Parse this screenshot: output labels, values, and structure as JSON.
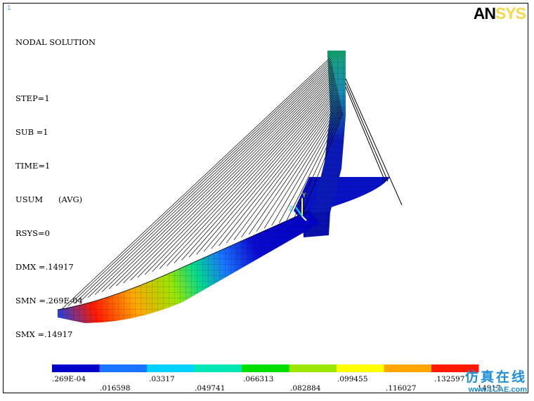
{
  "window_number": "1",
  "logo": {
    "part1": "AN",
    "part2": "SYS"
  },
  "info_lines": [
    "NODAL SOLUTION",
    "",
    "STEP=1",
    "SUB =1",
    "TIME=1",
    "USUM      (AVG)",
    "RSYS=0",
    "DMX =.14917",
    "SMN =.269E-04",
    "SMX =.14917"
  ],
  "legend": {
    "colors": [
      "#0000c8",
      "#1a73ff",
      "#00d2ff",
      "#00e6b4",
      "#00e000",
      "#9ae600",
      "#ffff00",
      "#ffa600",
      "#ff1a00"
    ],
    "labels_low": [
      ".269E-04",
      ".03317",
      ".066313",
      ".099455",
      ".132597"
    ],
    "labels_high": [
      ".016598",
      ".049741",
      ".082884",
      ".116027",
      ".14917"
    ]
  },
  "triad": {
    "x": "X",
    "y": "Y",
    "z": "Z"
  },
  "watermark": {
    "cn": "仿真在线",
    "url": "www.1CAE.com"
  }
}
